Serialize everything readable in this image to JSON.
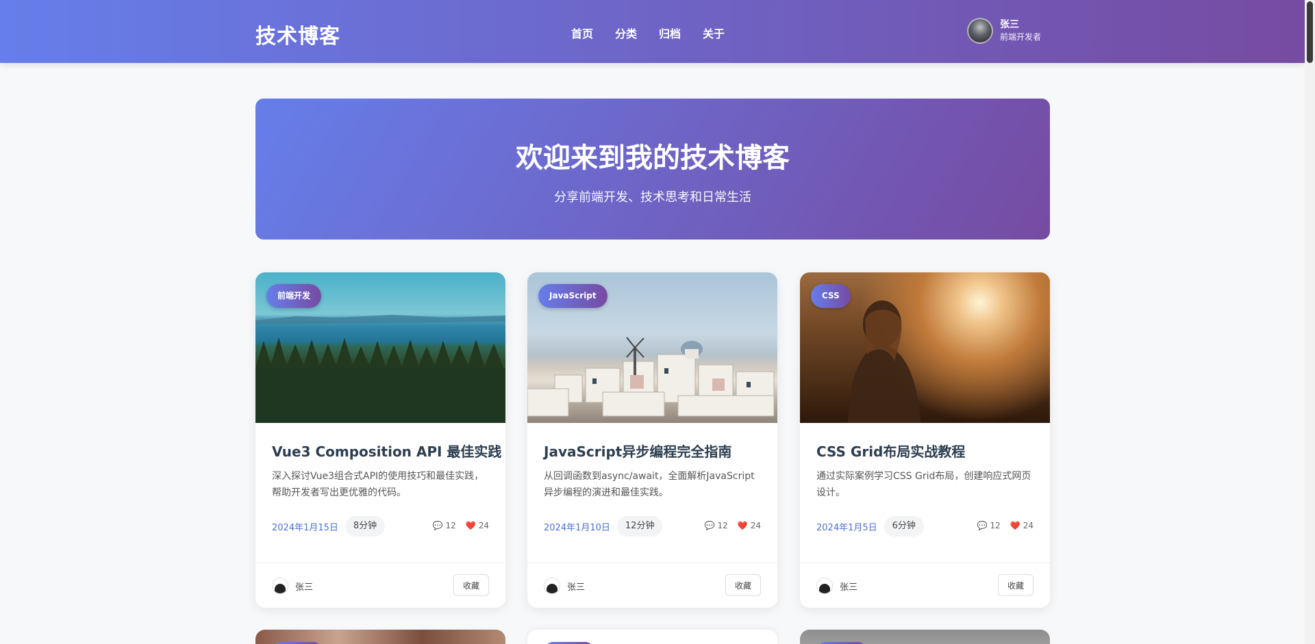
{
  "header": {
    "brand": "技术博客",
    "nav": [
      "首页",
      "分类",
      "归档",
      "关于"
    ],
    "user": {
      "name": "张三",
      "role": "前端开发者"
    }
  },
  "hero": {
    "title": "欢迎来到我的技术博客",
    "subtitle": "分享前端开发、技术思考和日常生活"
  },
  "cards": [
    {
      "tag": "前端开发",
      "title": "Vue3 Composition API 最佳实践",
      "excerpt": "深入探讨Vue3组合式API的使用技巧和最佳实践，帮助开发者写出更优雅的代码。",
      "date": "2024年1月15日",
      "read_time": "8分钟",
      "comments": "12",
      "likes": "24",
      "author": "张三",
      "fav_label": "收藏"
    },
    {
      "tag": "JavaScript",
      "title": "JavaScript异步编程完全指南",
      "excerpt": "从回调函数到async/await，全面解析JavaScript异步编程的演进和最佳实践。",
      "date": "2024年1月10日",
      "read_time": "12分钟",
      "comments": "12",
      "likes": "24",
      "author": "张三",
      "fav_label": "收藏"
    },
    {
      "tag": "CSS",
      "title": "CSS Grid布局实战教程",
      "excerpt": "通过实际案例学习CSS Grid布局，创建响应式网页设计。",
      "date": "2024年1月5日",
      "read_time": "6分钟",
      "comments": "12",
      "likes": "24",
      "author": "张三",
      "fav_label": "收藏"
    }
  ],
  "icons": {
    "comment": "speech-bubble-icon",
    "like": "heart-icon"
  },
  "colors": {
    "gradient_start": "#667eea",
    "gradient_end": "#764ba2",
    "date_blue": "#4a6fd6"
  }
}
